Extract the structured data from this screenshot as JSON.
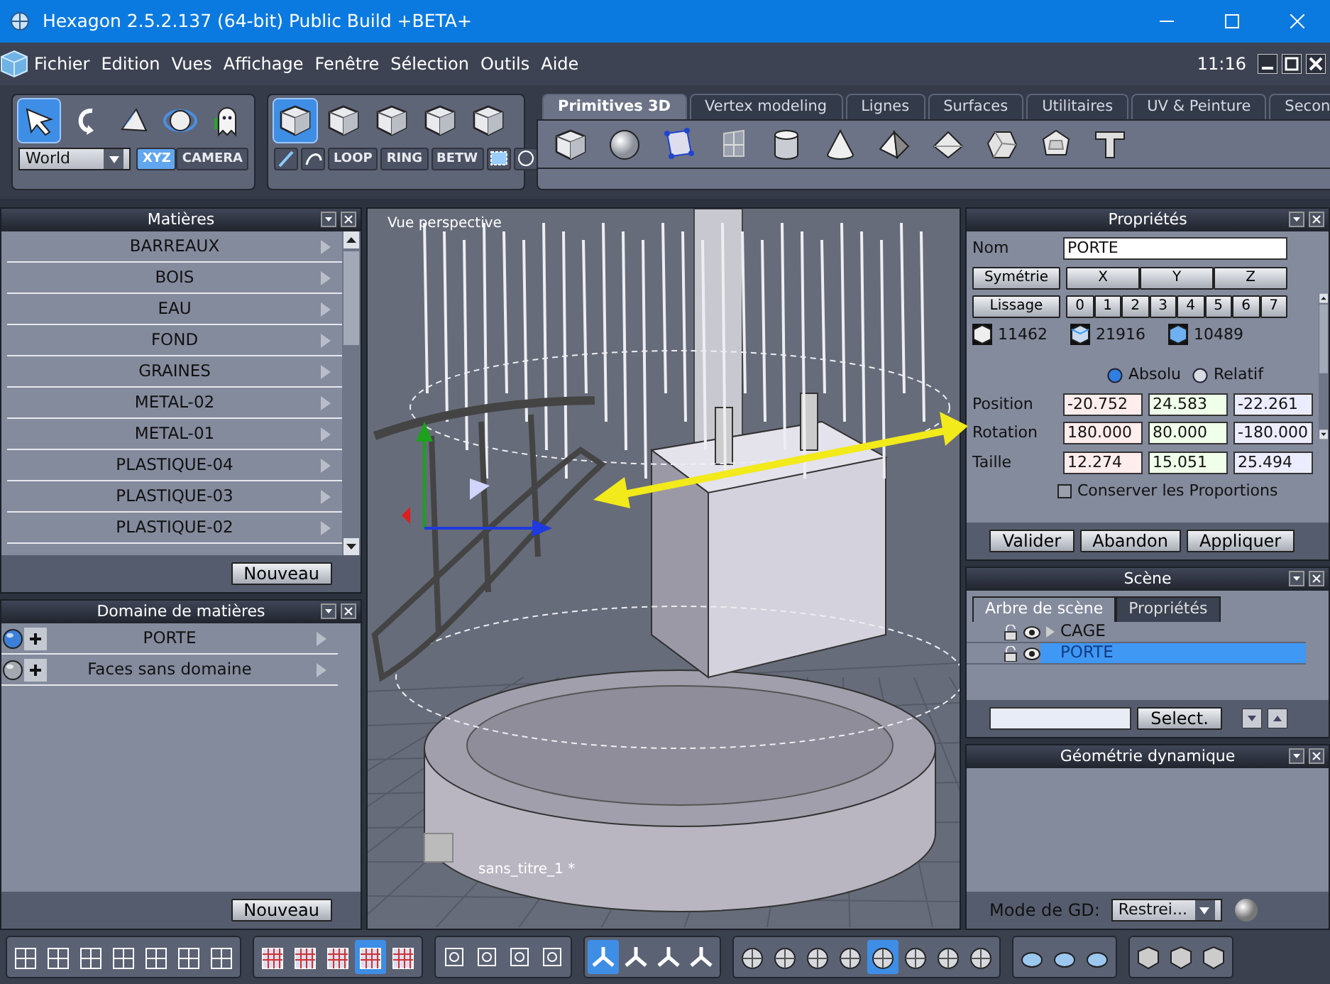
{
  "window": {
    "title": "Hexagon 2.5.2.137 (64-bit)  Public Build +BETA+"
  },
  "menu": [
    "Fichier",
    "Edition",
    "Vues",
    "Affichage",
    "Fenêtre",
    "Sélection",
    "Outils",
    "Aide"
  ],
  "clock": "11:16",
  "manipulators": [
    {
      "selected": true
    },
    {
      "selected": false
    },
    {
      "selected": false
    },
    {
      "selected": false
    },
    {
      "selected": false
    }
  ],
  "coord_system": {
    "value": "World",
    "modes": [
      {
        "label": "XYZ",
        "selected": true
      },
      {
        "label": "CAMERA",
        "selected": false
      }
    ]
  },
  "selection_modes": [
    {
      "selected": true
    },
    {
      "selected": false
    },
    {
      "selected": false
    },
    {
      "selected": false
    },
    {
      "selected": false
    }
  ],
  "selection_tools": [
    "LOOP",
    "RING",
    "BETW"
  ],
  "tabs": [
    {
      "label": "Primitives 3D",
      "selected": true
    },
    {
      "label": "Vertex modeling",
      "selected": false
    },
    {
      "label": "Lignes",
      "selected": false
    },
    {
      "label": "Surfaces",
      "selected": false
    },
    {
      "label": "Utilitaires",
      "selected": false
    },
    {
      "label": "UV & Peinture",
      "selected": false
    },
    {
      "label": "Secon",
      "selected": false
    }
  ],
  "materials": {
    "title": "Matières",
    "items": [
      "BARREAUX",
      "BOIS",
      "EAU",
      "FOND",
      "GRAINES",
      "METAL-02",
      "METAL-01",
      "PLASTIQUE-04",
      "PLASTIQUE-03",
      "PLASTIQUE-02"
    ],
    "button": "Nouveau"
  },
  "domains": {
    "title": "Domaine de matières",
    "items": [
      {
        "label": "PORTE",
        "color": "#3d7fd8"
      },
      {
        "label": "Faces sans domaine",
        "color": "#a4a8b0"
      }
    ],
    "button": "Nouveau"
  },
  "viewport": {
    "label": "Vue perspective",
    "document": "sans_titre_1 *"
  },
  "properties": {
    "title": "Propriétés",
    "name_label": "Nom",
    "name_value": "PORTE",
    "symmetry_button": "Symétrie",
    "axes": [
      "X",
      "Y",
      "Z"
    ],
    "smoothing_button": "Lissage",
    "levels": [
      "0",
      "1",
      "2",
      "3",
      "4",
      "5",
      "6",
      "7"
    ],
    "counts": [
      "11462",
      "21916",
      "10489"
    ],
    "modes": [
      {
        "label": "Absolu",
        "selected": true
      },
      {
        "label": "Relatif",
        "selected": false
      }
    ],
    "rows": [
      {
        "label": "Position",
        "values": [
          "-20.752",
          "24.583",
          "-22.261"
        ]
      },
      {
        "label": "Rotation",
        "values": [
          "180.000",
          "80.000",
          "-180.000"
        ]
      },
      {
        "label": "Taille",
        "values": [
          "12.274",
          "15.051",
          "25.494"
        ]
      }
    ],
    "keep_proportions": {
      "label": "Conserver les Proportions",
      "checked": false
    },
    "buttons": [
      "Valider",
      "Abandon",
      "Appliquer"
    ]
  },
  "scene": {
    "title": "Scène",
    "tabs": [
      {
        "label": "Arbre de scène",
        "selected": true
      },
      {
        "label": "Propriétés",
        "selected": false
      }
    ],
    "tree": [
      {
        "label": "CAGE",
        "selected": false,
        "expanded": false
      },
      {
        "label": "PORTE",
        "selected": true
      }
    ],
    "select_button": "Select."
  },
  "dynamic_geometry": {
    "title": "Géométrie dynamique",
    "mode_label": "Mode de GD:",
    "mode_value": "Restrei..."
  },
  "bottom_toolbar": [
    [
      {
        "selected": false
      },
      {
        "selected": false
      },
      {
        "selected": false
      },
      {
        "selected": false
      },
      {
        "selected": false
      },
      {
        "selected": false
      },
      {
        "selected": false
      }
    ],
    [
      {
        "selected": false
      },
      {
        "selected": false
      },
      {
        "selected": false
      },
      {
        "selected": true
      },
      {
        "selected": false
      }
    ],
    [
      {
        "selected": false
      },
      {
        "selected": false
      },
      {
        "selected": false
      },
      {
        "selected": false
      }
    ],
    [
      {
        "selected": true
      },
      {
        "selected": false
      },
      {
        "selected": false
      },
      {
        "selected": false
      }
    ],
    [
      {
        "selected": false
      },
      {
        "selected": false
      },
      {
        "selected": false
      },
      {
        "selected": false
      },
      {
        "selected": true
      },
      {
        "selected": false
      },
      {
        "selected": false
      },
      {
        "selected": false
      }
    ],
    [
      {
        "selected": false
      },
      {
        "selected": false
      },
      {
        "selected": false
      }
    ],
    [
      {
        "selected": false
      },
      {
        "selected": false
      },
      {
        "selected": false
      }
    ]
  ]
}
